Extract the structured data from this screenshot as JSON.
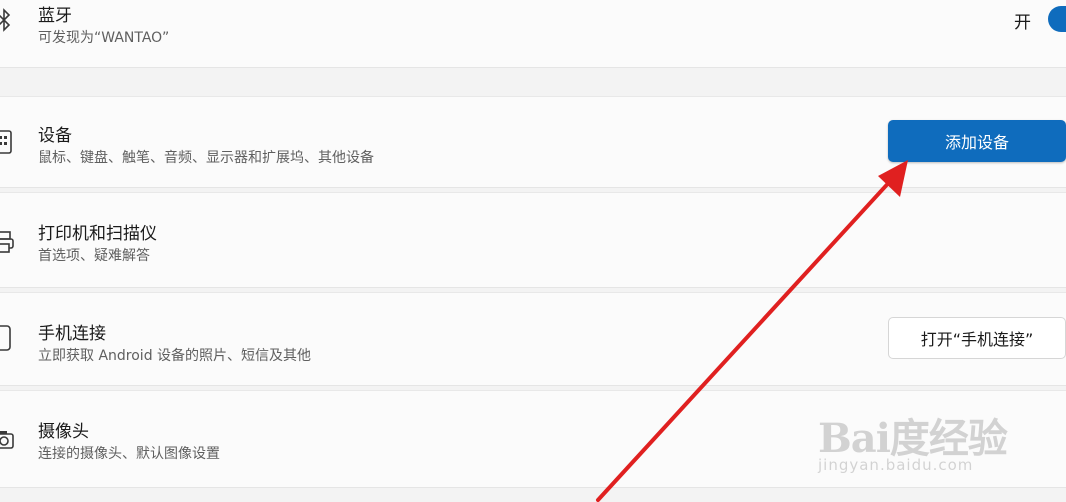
{
  "bluetooth": {
    "title": "蓝牙",
    "desc": "可发现为“WANTAO”",
    "toggle_label": "开",
    "toggle_on": true,
    "icon": "bluetooth-icon"
  },
  "devices": {
    "title": "设备",
    "desc": "鼠标、键盘、触笔、音频、显示器和扩展坞、其他设备",
    "button": "添加设备",
    "icon": "keyboard-device-icon"
  },
  "printers": {
    "title": "打印机和扫描仪",
    "desc": "首选项、疑难解答",
    "icon": "printer-icon"
  },
  "phone": {
    "title": "手机连接",
    "desc": "立即获取 Android 设备的照片、短信及其他",
    "button": "打开“手机连接”",
    "icon": "phone-icon"
  },
  "camera": {
    "title": "摄像头",
    "desc": "连接的摄像头、默认图像设置",
    "icon": "camera-icon"
  },
  "watermark": {
    "brand": "Bai度经验",
    "site": "jingyan.baidu.com"
  },
  "colors": {
    "accent": "#0f6cbd",
    "arrow": "#e02020"
  }
}
